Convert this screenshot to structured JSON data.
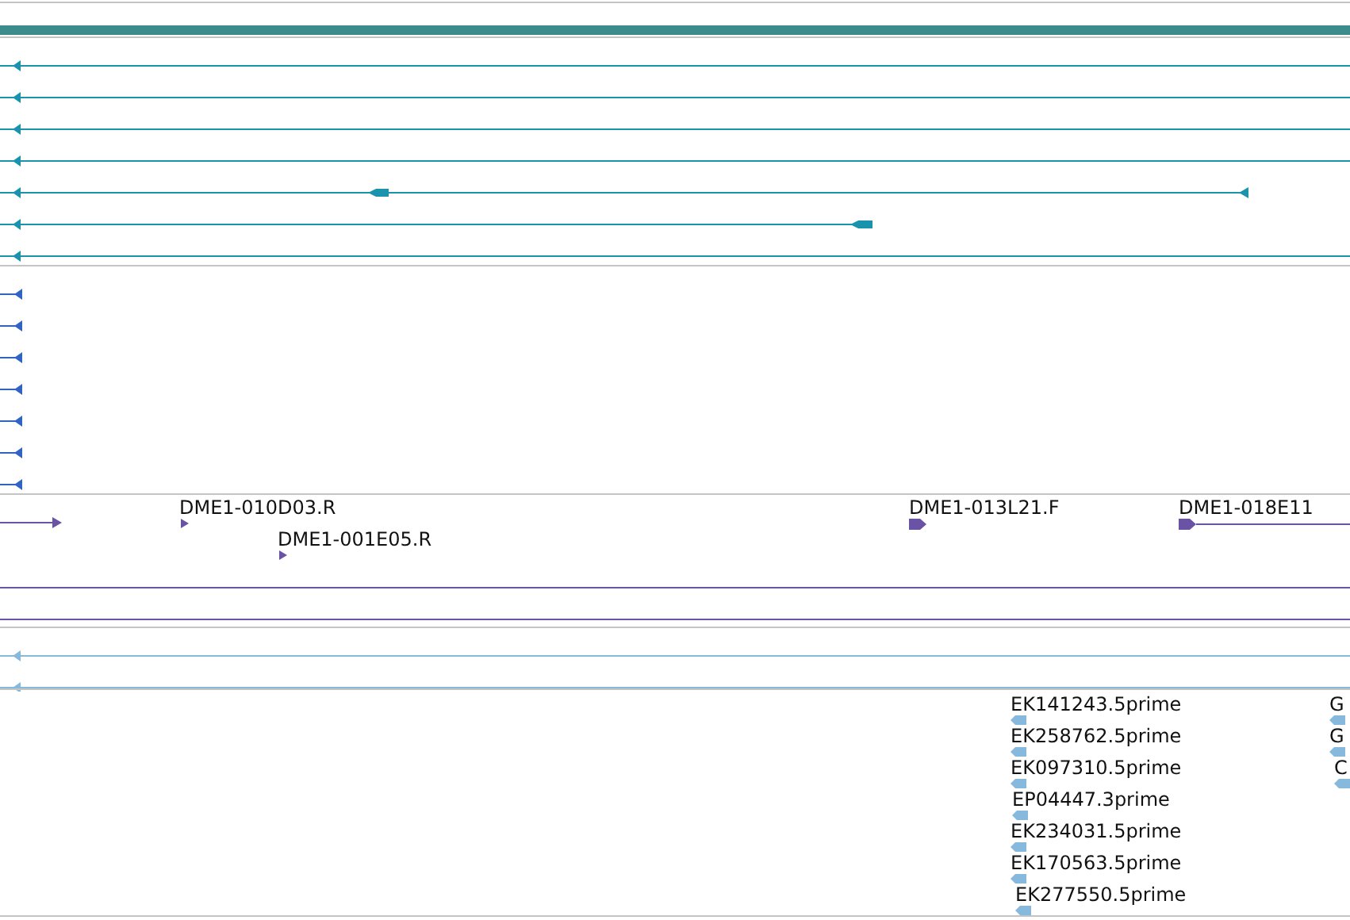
{
  "tracks": [
    {
      "kind": "clone_ends",
      "features": [
        {
          "label": "DME1-010D03.R"
        },
        {
          "label": "DME1-001E05.R"
        },
        {
          "label": "DME1-013L21.F"
        },
        {
          "label": "DME1-018E11"
        }
      ]
    },
    {
      "kind": "est_reads",
      "features": [
        {
          "label": "EK141243.5prime"
        },
        {
          "label": "EK258762.5prime"
        },
        {
          "label": "EK097310.5prime"
        },
        {
          "label": "EP04447.3prime"
        },
        {
          "label": "EK234031.5prime"
        },
        {
          "label": "EK170563.5prime"
        },
        {
          "label": "EK277550.5prime"
        },
        {
          "label": "G"
        },
        {
          "label": "G"
        },
        {
          "label": "C"
        }
      ]
    }
  ]
}
